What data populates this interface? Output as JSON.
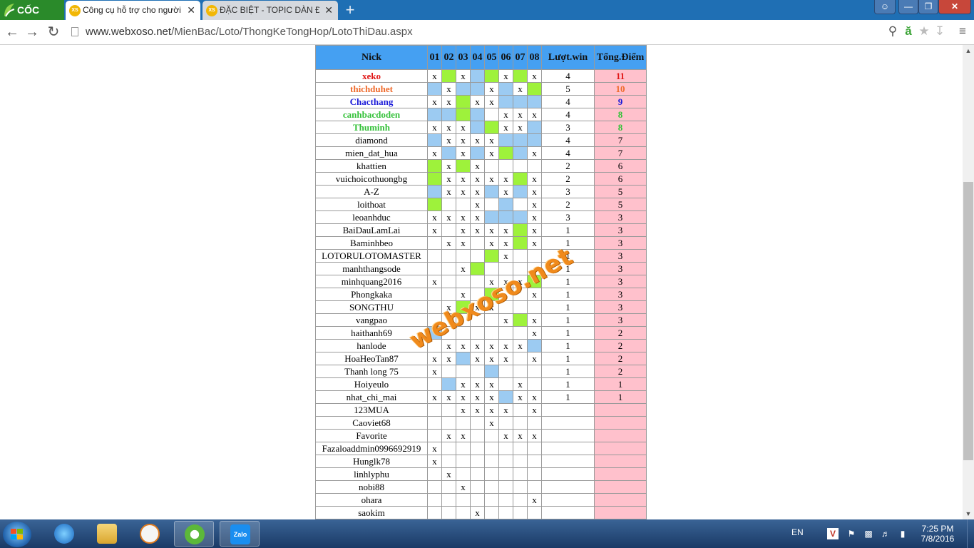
{
  "browser": {
    "brand": "CỐC CỐC",
    "tabs": [
      {
        "label": "Công cụ hỗ trợ cho người",
        "favicon": "XS",
        "active": true
      },
      {
        "label": "ĐẶC BIỆT - TOPIC DÀN ĐỀ",
        "favicon": "XS",
        "active": false
      }
    ],
    "url_host": "www.webxoso.net",
    "url_path": "/MienBac/Loto/ThongKeTongHop/LotoThiDau.aspx"
  },
  "table": {
    "headers": [
      "Nick",
      "01",
      "02",
      "03",
      "04",
      "05",
      "06",
      "07",
      "08",
      "Lượt.win",
      "Tổng.Điểm"
    ],
    "rows": [
      {
        "nick": "xeko",
        "color": "red",
        "cells": [
          "x",
          "g",
          "x",
          "b",
          "g",
          "x",
          "g",
          "x"
        ],
        "wins": "4",
        "points": "11"
      },
      {
        "nick": "thichduhet",
        "color": "orange",
        "cells": [
          "b",
          "x",
          "b",
          "b",
          "x",
          "b",
          "x",
          "g"
        ],
        "wins": "5",
        "points": "10"
      },
      {
        "nick": "Chacthang",
        "color": "blue",
        "cells": [
          "x",
          "x",
          "g",
          "x",
          "x",
          "b",
          "b",
          "b"
        ],
        "wins": "4",
        "points": "9"
      },
      {
        "nick": "canhbacdoden",
        "color": "green",
        "cells": [
          "b",
          "b",
          "g",
          "b",
          "",
          "x",
          "x",
          "x"
        ],
        "wins": "4",
        "points": "8"
      },
      {
        "nick": "Thuminh",
        "color": "green",
        "cells": [
          "x",
          "x",
          "x",
          "b",
          "g",
          "x",
          "x",
          "b"
        ],
        "wins": "3",
        "points": "8"
      },
      {
        "nick": "diamond",
        "color": "",
        "cells": [
          "b",
          "x",
          "x",
          "x",
          "x",
          "b",
          "b",
          "b"
        ],
        "wins": "4",
        "points": "7"
      },
      {
        "nick": "mien_dat_hua",
        "color": "",
        "cells": [
          "x",
          "b",
          "x",
          "b",
          "x",
          "g",
          "b",
          "x"
        ],
        "wins": "4",
        "points": "7"
      },
      {
        "nick": "khattien",
        "color": "",
        "cells": [
          "g",
          "x",
          "g",
          "x",
          "",
          "",
          "",
          ""
        ],
        "wins": "2",
        "points": "6"
      },
      {
        "nick": "vuichoicothuongbg",
        "color": "",
        "cells": [
          "g",
          "x",
          "x",
          "x",
          "x",
          "x",
          "g",
          "x"
        ],
        "wins": "2",
        "points": "6"
      },
      {
        "nick": "A-Z",
        "color": "",
        "cells": [
          "b",
          "x",
          "x",
          "x",
          "b",
          "x",
          "b",
          "x"
        ],
        "wins": "3",
        "points": "5"
      },
      {
        "nick": "loithoat",
        "color": "",
        "cells": [
          "g",
          "",
          "",
          "x",
          "",
          "b",
          "",
          "x"
        ],
        "wins": "2",
        "points": "5"
      },
      {
        "nick": "leoanhduc",
        "color": "",
        "cells": [
          "x",
          "x",
          "x",
          "x",
          "b",
          "b",
          "b",
          "x"
        ],
        "wins": "3",
        "points": "3"
      },
      {
        "nick": "BaiDauLamLai",
        "color": "",
        "cells": [
          "x",
          "",
          "x",
          "x",
          "x",
          "x",
          "g",
          "x"
        ],
        "wins": "1",
        "points": "3"
      },
      {
        "nick": "Baminhbeo",
        "color": "",
        "cells": [
          "",
          "x",
          "x",
          "",
          "x",
          "x",
          "g",
          "x"
        ],
        "wins": "1",
        "points": "3"
      },
      {
        "nick": "LOTORULOTOMASTER",
        "color": "",
        "cells": [
          "",
          "",
          "",
          "",
          "g",
          "x",
          "",
          ""
        ],
        "wins": "1",
        "points": "3"
      },
      {
        "nick": "manhthangsode",
        "color": "",
        "cells": [
          "",
          "",
          "x",
          "g",
          "",
          "",
          "",
          ""
        ],
        "wins": "1",
        "points": "3"
      },
      {
        "nick": "minhquang2016",
        "color": "",
        "cells": [
          "x",
          "",
          "",
          "",
          "x",
          "x",
          "x",
          "g"
        ],
        "wins": "1",
        "points": "3"
      },
      {
        "nick": "Phongkaka",
        "color": "",
        "cells": [
          "",
          "",
          "x",
          "",
          "g",
          "",
          "",
          "x"
        ],
        "wins": "1",
        "points": "3"
      },
      {
        "nick": "SONGTHU",
        "color": "",
        "cells": [
          "",
          "x",
          "g",
          "x",
          "x",
          "",
          "",
          ""
        ],
        "wins": "1",
        "points": "3"
      },
      {
        "nick": "vangpao",
        "color": "",
        "cells": [
          "",
          "",
          "",
          "",
          "",
          "x",
          "g",
          "x"
        ],
        "wins": "1",
        "points": "3"
      },
      {
        "nick": "haithanh69",
        "color": "",
        "cells": [
          "b",
          "",
          "",
          "",
          "",
          "",
          "",
          "x"
        ],
        "wins": "1",
        "points": "2"
      },
      {
        "nick": "hanlode",
        "color": "",
        "cells": [
          "",
          "x",
          "x",
          "x",
          "x",
          "x",
          "x",
          "b"
        ],
        "wins": "1",
        "points": "2"
      },
      {
        "nick": "HoaHeoTan87",
        "color": "",
        "cells": [
          "x",
          "x",
          "b",
          "x",
          "x",
          "x",
          "",
          "x"
        ],
        "wins": "1",
        "points": "2"
      },
      {
        "nick": "Thanh long 75",
        "color": "",
        "cells": [
          "x",
          "",
          "",
          "",
          "b",
          "",
          "",
          ""
        ],
        "wins": "1",
        "points": "2"
      },
      {
        "nick": "Hoiyeulo",
        "color": "",
        "cells": [
          "",
          "b",
          "x",
          "x",
          "x",
          "",
          "x",
          ""
        ],
        "wins": "1",
        "points": "1"
      },
      {
        "nick": "nhat_chi_mai",
        "color": "",
        "cells": [
          "x",
          "x",
          "x",
          "x",
          "x",
          "b",
          "x",
          "x"
        ],
        "wins": "1",
        "points": "1"
      },
      {
        "nick": "123MUA",
        "color": "",
        "cells": [
          "",
          "",
          "x",
          "x",
          "x",
          "x",
          "",
          "x"
        ],
        "wins": "",
        "points": ""
      },
      {
        "nick": "Caoviet68",
        "color": "",
        "cells": [
          "",
          "",
          "",
          "",
          "x",
          "",
          "",
          ""
        ],
        "wins": "",
        "points": ""
      },
      {
        "nick": "Favorite",
        "color": "",
        "cells": [
          "",
          "x",
          "x",
          "",
          "",
          "x",
          "x",
          "x"
        ],
        "wins": "",
        "points": ""
      },
      {
        "nick": "Fazaloaddmin0996692919",
        "color": "",
        "cells": [
          "x",
          "",
          "",
          "",
          "",
          "",
          "",
          ""
        ],
        "wins": "",
        "points": ""
      },
      {
        "nick": "Hunglk78",
        "color": "",
        "cells": [
          "x",
          "",
          "",
          "",
          "",
          "",
          "",
          ""
        ],
        "wins": "",
        "points": ""
      },
      {
        "nick": "linhlyphu",
        "color": "",
        "cells": [
          "",
          "x",
          "",
          "",
          "",
          "",
          "",
          ""
        ],
        "wins": "",
        "points": ""
      },
      {
        "nick": "nobi88",
        "color": "",
        "cells": [
          "",
          "",
          "x",
          "",
          "",
          "",
          "",
          ""
        ],
        "wins": "",
        "points": ""
      },
      {
        "nick": "ohara",
        "color": "",
        "cells": [
          "",
          "",
          "",
          "",
          "",
          "",
          "",
          "x"
        ],
        "wins": "",
        "points": ""
      },
      {
        "nick": "saokim",
        "color": "",
        "cells": [
          "",
          "",
          "",
          "x",
          "",
          "",
          "",
          ""
        ],
        "wins": "",
        "points": ""
      }
    ]
  },
  "watermark": "webxoso.net",
  "taskbar": {
    "language": "EN",
    "time": "7:25 PM",
    "date": "7/8/2016",
    "apps": [
      "internet-explorer",
      "file-explorer",
      "media-player",
      "coccoc-browser",
      "zalo"
    ],
    "zalo_label": "Zalo"
  },
  "colors": {
    "header_blue": "#45a0f2",
    "cell_green": "#9ef23b",
    "cell_blue": "#9ccbf2",
    "points_pink": "#ffc1cc"
  }
}
